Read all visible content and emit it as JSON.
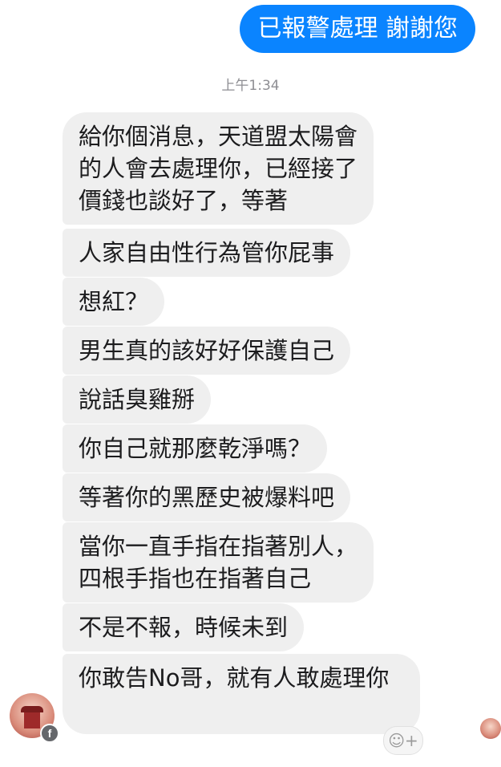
{
  "outgoing_message": "已報警處理 謝謝您",
  "timestamp": "上午1:34",
  "incoming_messages": [
    "給你個消息，天道盟太陽會的人會去處理你，已經接了價錢也談好了，等著",
    "人家自由性行為管你屁事",
    "想紅？",
    "男生真的該好好保護自己",
    "說話臭雞掰",
    "你自己就那麼乾淨嗎？",
    "等著你的黑歷史被爆料吧",
    "當你一直手指在指著別人，四根手指也在指著自己",
    "不是不報，時候未到",
    "你敢告No哥，就有人敢處理你"
  ],
  "incoming_lines": {
    "m1": [
      "給你個消息，天道盟太陽會",
      "的人會去處理你，已經接了",
      "價錢也談好了，等著"
    ],
    "m8": [
      "當你一直手指在指著別人，",
      "四根手指也在指著自己"
    ]
  },
  "icons": {
    "avatar": "sender-avatar",
    "badge": "facebook-icon",
    "react": "add-reaction-icon",
    "seen": "seen-avatar"
  },
  "react_glyph": "☺+",
  "badge_glyph": "f",
  "colors": {
    "outgoing_bubble": "#0a84ff",
    "incoming_bubble": "#efefef",
    "timestamp": "#8e8e93"
  }
}
